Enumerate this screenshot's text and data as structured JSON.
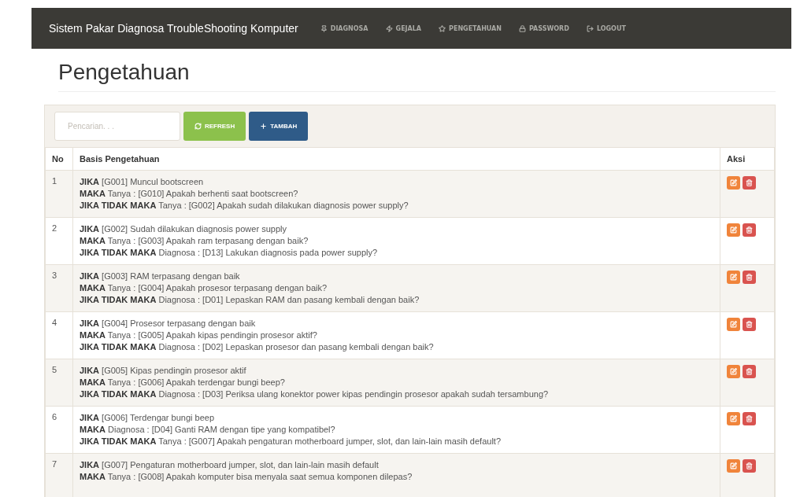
{
  "navbar": {
    "brand": "Sistem Pakar Diagnosa TroubleShooting Komputer",
    "items": [
      {
        "label": "DIAGNOSA"
      },
      {
        "label": "GEJALA"
      },
      {
        "label": "PENGETAHUAN"
      },
      {
        "label": "PASSWORD"
      },
      {
        "label": "LOGOUT"
      }
    ]
  },
  "page_title": "Pengetahuan",
  "toolbar": {
    "search": {
      "placeholder": "Pencarian. . ."
    },
    "buttons": [
      {
        "label": "REFRESH",
        "kind": "refresh"
      },
      {
        "label": "TAMBAH",
        "kind": "add"
      }
    ]
  },
  "table": {
    "columns": [
      "No",
      "Basis Pengetahuan",
      "Aksi"
    ],
    "rows": [
      {
        "no": "1",
        "lines": [
          "**JIKA** [G001] Muncul bootscreen",
          "**MAKA** Tanya : [G010] Apakah berhenti saat bootscreen?",
          "**JIKA TIDAK MAKA** Tanya : [G002] Apakah sudah dilakukan diagnosis power supply?"
        ]
      },
      {
        "no": "2",
        "lines": [
          "**JIKA** [G002] Sudah dilakukan diagnosis power supply",
          "**MAKA** Tanya : [G003] Apakah ram terpasang dengan baik?",
          "**JIKA TIDAK MAKA** Diagnosa : [D13] Lakukan diagnosis pada power supply?"
        ]
      },
      {
        "no": "3",
        "lines": [
          "**JIKA** [G003] RAM terpasang dengan baik",
          "**MAKA** Tanya : [G004] Apakah prosesor terpasang dengan baik?",
          "**JIKA TIDAK MAKA** Diagnosa : [D01] Lepaskan RAM dan pasang kembali dengan baik?"
        ]
      },
      {
        "no": "4",
        "lines": [
          "**JIKA** [G004] Prosesor terpasang dengan baik",
          "**MAKA** Tanya : [G005] Apakah kipas pendingin prosesor aktif?",
          "**JIKA TIDAK MAKA** Diagnosa : [D02] Lepaskan prosesor dan pasang kembali dengan baik?"
        ]
      },
      {
        "no": "5",
        "lines": [
          "**JIKA** [G005] Kipas pendingin prosesor aktif",
          "**MAKA** Tanya : [G006] Apakah terdengar bungi beep?",
          "**JIKA TIDAK MAKA** Diagnosa : [D03] Periksa ulang konektor power kipas pendingin prosesor apakah sudah tersambung?"
        ]
      },
      {
        "no": "6",
        "lines": [
          "**JIKA** [G006] Terdengar bungi beep",
          "**MAKA** Diagnosa : [D04] Ganti RAM dengan tipe yang kompatibel?",
          "**JIKA TIDAK MAKA** Tanya : [G007] Apakah pengaturan motherboard jumper, slot, dan lain-lain masih default?"
        ]
      },
      {
        "no": "7",
        "lines": [
          "**JIKA** [G007] Pengaturan motherboard jumper, slot, dan lain-lain masih default",
          "**MAKA** Tanya : [G008] Apakah komputer bisa menyala saat semua komponen dilepas?"
        ]
      }
    ]
  }
}
